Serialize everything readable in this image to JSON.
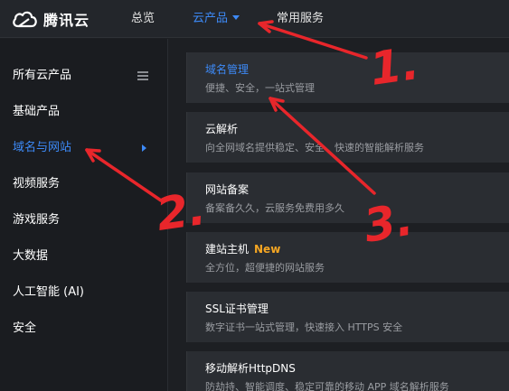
{
  "header": {
    "brand": "腾讯云",
    "nav": [
      {
        "label": "总览"
      },
      {
        "label": "云产品",
        "active": true
      },
      {
        "label": "常用服务"
      }
    ]
  },
  "sidebar": {
    "items": [
      {
        "label": "所有云产品"
      },
      {
        "label": "基础产品"
      },
      {
        "label": "域名与网站",
        "active": true
      },
      {
        "label": "视频服务"
      },
      {
        "label": "游戏服务"
      },
      {
        "label": "大数据"
      },
      {
        "label": "人工智能 (AI)"
      },
      {
        "label": "安全"
      }
    ]
  },
  "cards": [
    {
      "title": "域名管理",
      "desc": "便捷、安全，一站式管理"
    },
    {
      "title": "云解析",
      "desc": "向全网域名提供稳定、安全、快速的智能解析服务"
    },
    {
      "title": "网站备案",
      "desc": "备案备久久，云服务免费用多久"
    },
    {
      "title": "建站主机",
      "badge": "New",
      "desc": "全方位，超便捷的网站服务"
    },
    {
      "title": "SSL证书管理",
      "desc": "数字证书一站式管理，快速接入 HTTPS 安全"
    },
    {
      "title": "移动解析HttpDNS",
      "desc": "防劫持、智能调度、稳定可靠的移动 APP 域名解析服务"
    }
  ],
  "annotation_labels": [
    "1.",
    "2.",
    "3."
  ],
  "colors": {
    "accent": "#3d8af7",
    "annotation": "#e8262b",
    "badge": "#f5a623"
  }
}
